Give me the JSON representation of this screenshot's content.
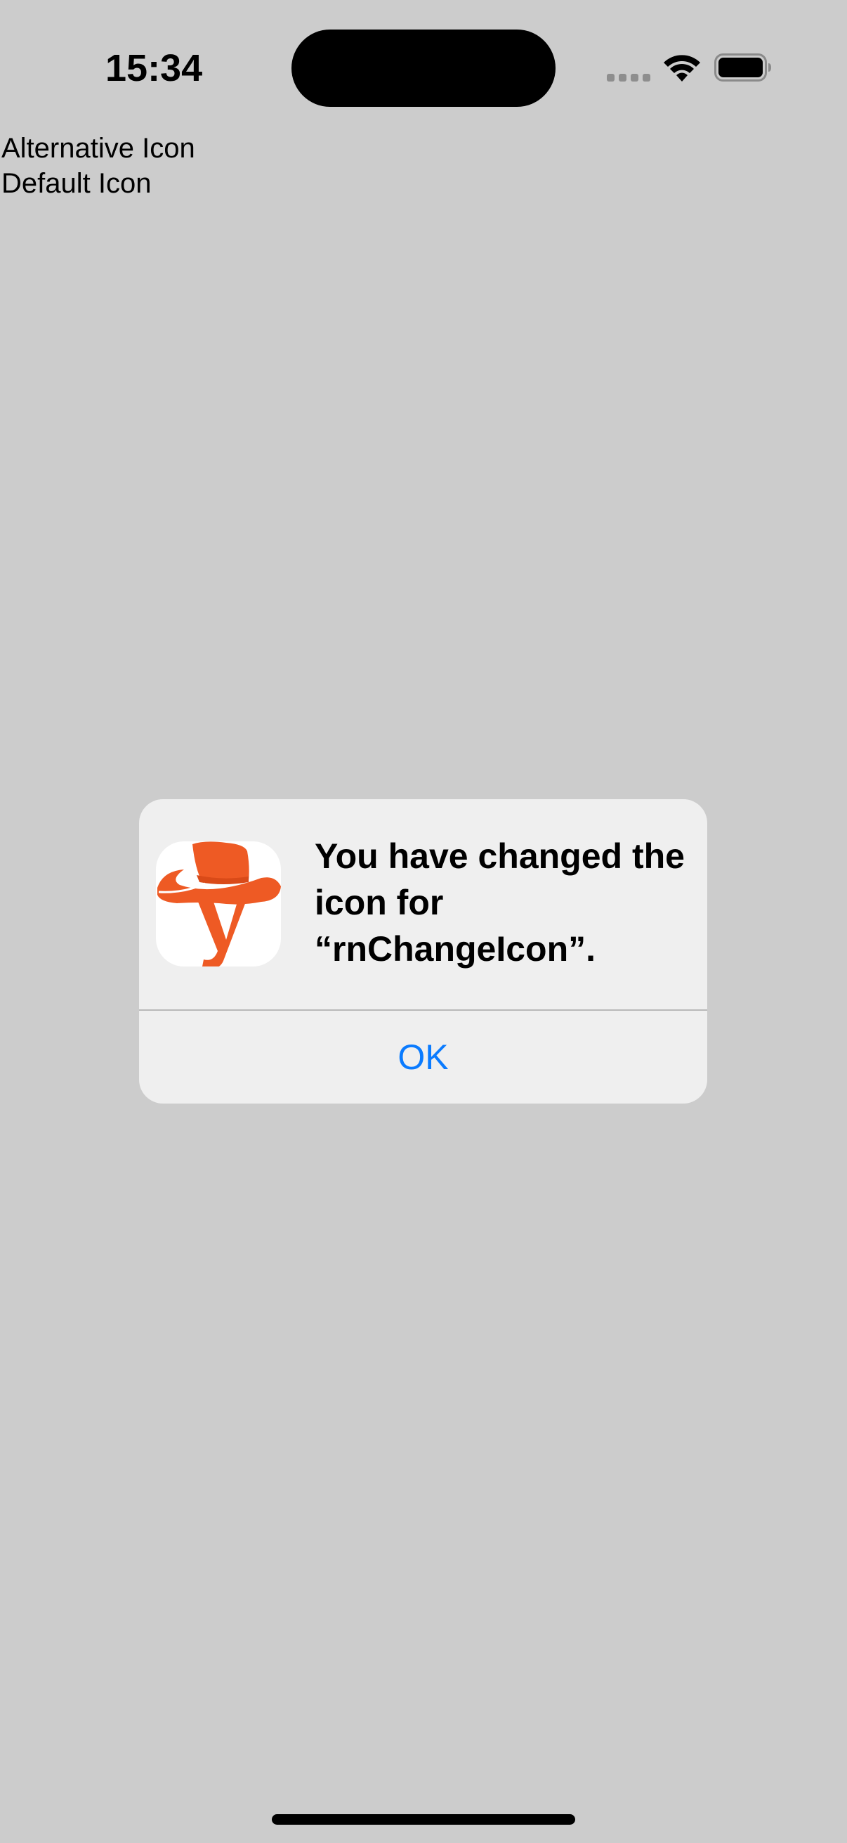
{
  "status_bar": {
    "time": "15:34",
    "icons": [
      "cellular-signal-icon",
      "wifi-icon",
      "battery-icon"
    ]
  },
  "list": {
    "items": [
      {
        "label": "Alternative Icon"
      },
      {
        "label": "Default Icon"
      }
    ]
  },
  "alert": {
    "app_icon": "cowboy-hat-y-app-icon",
    "message": "You have changed the icon for “rnChangeIcon”.",
    "ok_label": "OK"
  },
  "colors": {
    "background": "#cccccc",
    "alert_background": "#efefef",
    "accent": "#0a7bff",
    "icon_orange": "#ee5a24"
  }
}
